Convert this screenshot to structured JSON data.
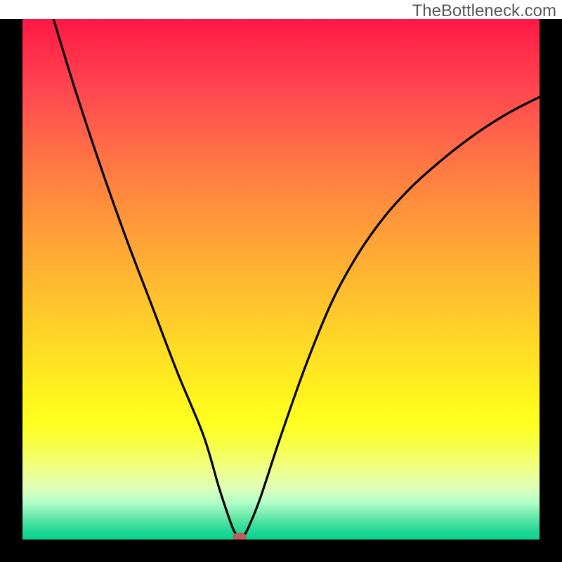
{
  "watermark": "TheBottleneck.com",
  "chart_data": {
    "type": "line",
    "title": "",
    "xlabel": "",
    "ylabel": "",
    "xlim": [
      0,
      100
    ],
    "ylim": [
      0,
      100
    ],
    "series": [
      {
        "name": "bottleneck-curve",
        "x": [
          6,
          10,
          15,
          20,
          25,
          30,
          35,
          38,
          40,
          41,
          42,
          43,
          44,
          46,
          50,
          55,
          60,
          65,
          70,
          75,
          80,
          85,
          90,
          95,
          100
        ],
        "values": [
          100,
          87,
          72,
          58,
          45,
          32,
          20,
          10,
          4,
          1.5,
          0.5,
          1,
          3,
          8,
          20,
          34,
          46,
          55,
          62,
          67.5,
          72,
          76,
          79.5,
          82.5,
          85
        ]
      }
    ],
    "minimum_marker": {
      "x": 42,
      "y": 0.5,
      "color": "#bd5d5d"
    },
    "background_gradient": {
      "top": "#ff1744",
      "mid": "#ffea20",
      "bottom": "#08d290"
    }
  }
}
